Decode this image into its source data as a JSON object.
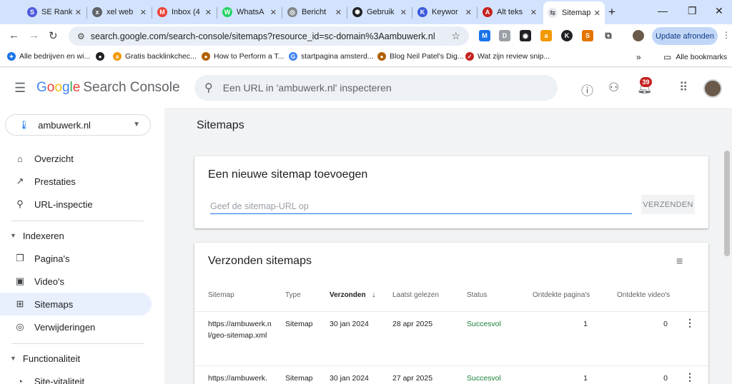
{
  "browser": {
    "tabs": [
      {
        "label": "SE Ranki",
        "icon": "se-ranking-icon",
        "color": "#4d5bdb"
      },
      {
        "label": "xel web",
        "icon": "xel-icon",
        "color": "#5f6368"
      },
      {
        "label": "Inbox (4",
        "icon": "gmail-icon",
        "color": "#ea4335"
      },
      {
        "label": "WhatsA",
        "icon": "whatsapp-icon",
        "color": "#25d366"
      },
      {
        "label": "Bericht",
        "icon": "globe-icon",
        "color": "#80868b"
      },
      {
        "label": "Gebruik",
        "icon": "chatgpt-icon",
        "color": "#202124"
      },
      {
        "label": "Keywor",
        "icon": "keyword-icon",
        "color": "#3b5bdb"
      },
      {
        "label": "Alt teks",
        "icon": "alt-text-icon",
        "color": "#c5221f"
      },
      {
        "label": "Sitemap",
        "icon": "search-console-icon",
        "color": "#5f6368"
      }
    ],
    "url": "search.google.com/search-console/sitemaps?resource_id=sc-domain%3Aambuwerk.nl",
    "update_label": "Update afronden",
    "bookmarks": [
      {
        "label": "Alle bedrijven en wi...",
        "color": "#1a73e8"
      },
      {
        "label": "",
        "color": "#202124"
      },
      {
        "label": "Gratis backlinkchec...",
        "color": "#f29900"
      },
      {
        "label": "How to Perform a T...",
        "color": "#b06000"
      },
      {
        "label": "startpagina amsterd...",
        "color": "#4285f4"
      },
      {
        "label": "Blog Neil Patel's Dig...",
        "color": "#b06000"
      },
      {
        "label": "Wat zijn review snip...",
        "color": "#c5221f"
      }
    ],
    "all_bookmarks_label": "Alle bookmarks",
    "notification_count": "39"
  },
  "header": {
    "logo_google": "Google",
    "logo_product": "Search Console",
    "search_placeholder": "Een URL in 'ambuwerk.nl' inspecteren"
  },
  "sidebar": {
    "property": "ambuwerk.nl",
    "items": [
      {
        "label": "Overzicht",
        "icon": "home-icon"
      },
      {
        "label": "Prestaties",
        "icon": "trending-icon"
      },
      {
        "label": "URL-inspectie",
        "icon": "search-icon"
      }
    ],
    "groups": [
      {
        "label": "Indexeren"
      },
      {
        "label": "Functionaliteit"
      }
    ],
    "index_items": [
      {
        "label": "Pagina's",
        "icon": "pages-icon"
      },
      {
        "label": "Video's",
        "icon": "video-icon"
      },
      {
        "label": "Sitemaps",
        "icon": "sitemap-icon"
      },
      {
        "label": "Verwijderingen",
        "icon": "eye-off-icon"
      }
    ],
    "feature_items": [
      {
        "label": "Site-vitaliteit",
        "icon": "gauge-icon"
      }
    ]
  },
  "main": {
    "title": "Sitemaps",
    "add": {
      "title": "Een nieuwe sitemap toevoegen",
      "placeholder": "Geef de sitemap-URL op",
      "submit_label": "VERZENDEN"
    },
    "submitted": {
      "title": "Verzonden sitemaps",
      "columns": [
        "Sitemap",
        "Type",
        "Verzonden",
        "Laatst gelezen",
        "Status",
        "Ontdekte pagina's",
        "Ontdekte video's"
      ],
      "sort_indicator": "↓",
      "rows": [
        {
          "sitemap": "https://ambuwerk.nl/geo-sitemap.xml",
          "type": "Sitemap",
          "submitted": "30 jan 2024",
          "last_read": "28 apr 2025",
          "status": "Succesvol",
          "pages": "1",
          "videos": "0"
        },
        {
          "sitemap": "https://ambuwerk.",
          "type": "Sitemap",
          "submitted": "30 jan 2024",
          "last_read": "27 apr 2025",
          "status": "Succesvol",
          "pages": "1",
          "videos": "0"
        }
      ]
    }
  },
  "colors": {
    "accent": "#1a73e8",
    "success": "#188038",
    "active_nav": "#e8f0fe",
    "badge": "#c5221f"
  }
}
